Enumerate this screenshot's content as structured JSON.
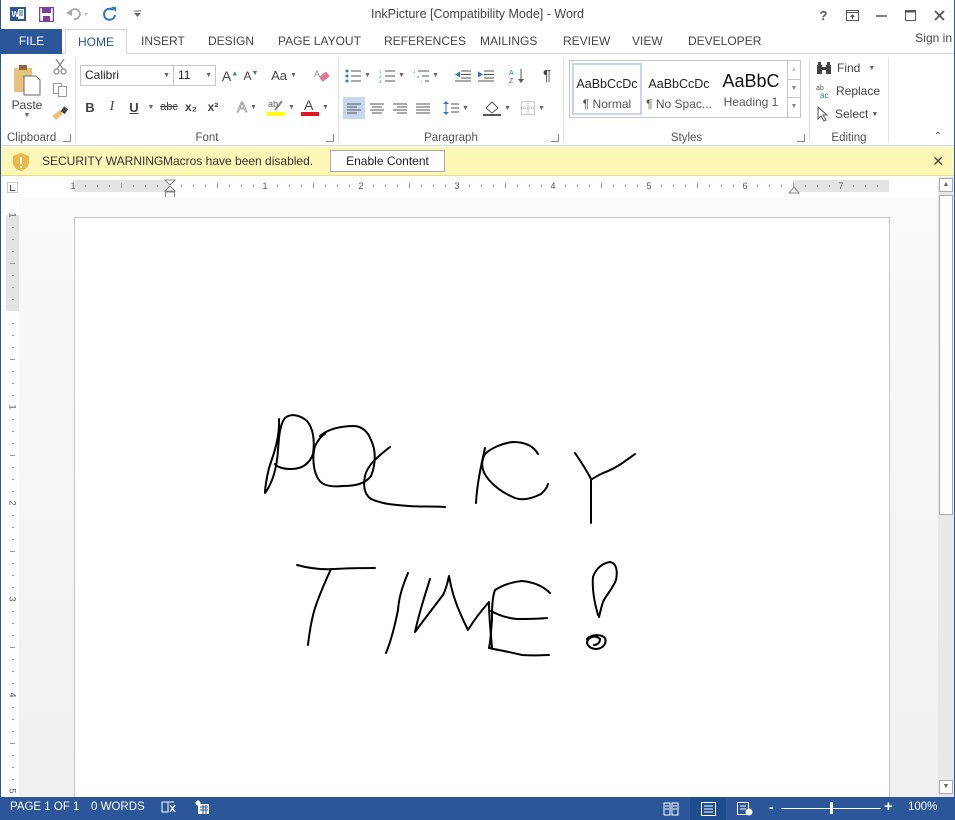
{
  "window": {
    "title": "InkPicture [Compatibility Mode] - Word",
    "controls": {
      "help": "?",
      "ribbon_options": "ribbon-display-options",
      "minimize": "minimize",
      "maximize": "maximize",
      "close": "close"
    }
  },
  "qat": {
    "icons": [
      "word-app-icon",
      "save-icon",
      "undo-icon",
      "redo-icon",
      "customize-qat-icon"
    ]
  },
  "tabs": {
    "file": "FILE",
    "items": [
      {
        "label": "HOME",
        "active": true
      },
      {
        "label": "INSERT",
        "active": false
      },
      {
        "label": "DESIGN",
        "active": false
      },
      {
        "label": "PAGE LAYOUT",
        "active": false
      },
      {
        "label": "REFERENCES",
        "active": false
      },
      {
        "label": "MAILINGS",
        "active": false
      },
      {
        "label": "REVIEW",
        "active": false
      },
      {
        "label": "VIEW",
        "active": false
      },
      {
        "label": "DEVELOPER",
        "active": false
      }
    ],
    "signin": "Sign in"
  },
  "ribbon": {
    "clipboard": {
      "label": "Clipboard",
      "paste": "Paste"
    },
    "font": {
      "label": "Font",
      "font_name": "Calibri",
      "font_size": "11",
      "change_case": "Aa",
      "bold": "B",
      "italic": "I",
      "underline": "U",
      "strikethrough": "abc",
      "subscript": "x₂",
      "superscript": "x²",
      "highlight_color": "#ffff00",
      "font_color": "#e81123"
    },
    "paragraph": {
      "label": "Paragraph",
      "show_marks": "¶"
    },
    "styles": {
      "label": "Styles",
      "items": [
        {
          "preview": "AaBbCcDc",
          "name": "¶ Normal",
          "selected": true
        },
        {
          "preview": "AaBbCcDc",
          "name": "¶ No Spac...",
          "selected": false
        },
        {
          "preview": "AaBbC",
          "name": "Heading 1",
          "selected": false
        }
      ]
    },
    "editing": {
      "label": "Editing",
      "find": "Find",
      "replace": "Replace",
      "select": "Select"
    }
  },
  "security_bar": {
    "title": "SECURITY WARNING",
    "message": "Macros have been disabled.",
    "button": "Enable Content"
  },
  "ruler": {
    "horizontal_labels": [
      "1",
      "1",
      "2",
      "3",
      "4",
      "5",
      "6",
      "7"
    ],
    "vertical_labels": [
      "1",
      "1",
      "2",
      "3",
      "4",
      "5"
    ]
  },
  "document": {
    "ink_text": "POLICY TIME!"
  },
  "statusbar": {
    "page": "PAGE 1 OF 1",
    "words": "0 WORDS",
    "zoom": "100%",
    "zoom_minus": "-",
    "zoom_plus": "+",
    "zoom_percent": 100
  }
}
